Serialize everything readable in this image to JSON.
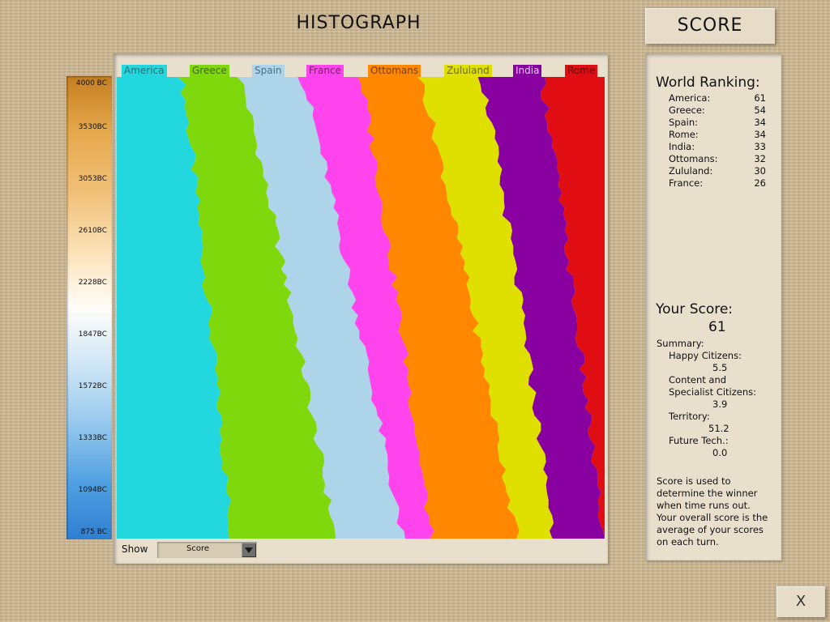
{
  "window": {
    "title": "HISTOGRAPH",
    "score_tab": "SCORE",
    "close_label": "X"
  },
  "timeline": {
    "ticks": [
      "4000 BC",
      "3530BC",
      "3053BC",
      "2610BC",
      "2228BC",
      "1847BC",
      "1572BC",
      "1333BC",
      "1094BC",
      "875 BC"
    ]
  },
  "legend": [
    {
      "name": "America",
      "color": "#22d8de",
      "text_color": "#2a6f77"
    },
    {
      "name": "Greece",
      "color": "#7ed80c",
      "text_color": "#3d6d0d"
    },
    {
      "name": "Spain",
      "color": "#aed4ea",
      "text_color": "#4a6f86"
    },
    {
      "name": "France",
      "color": "#ff44ee",
      "text_color": "#7a1f70"
    },
    {
      "name": "Ottomans",
      "color": "#ff8800",
      "text_color": "#7a3c00"
    },
    {
      "name": "Zululand",
      "color": "#e0e000",
      "text_color": "#6b6b00"
    },
    {
      "name": "India",
      "color": "#8800a0",
      "text_color": "#e8c8ff"
    },
    {
      "name": "Rome",
      "color": "#e00d12",
      "text_color": "#6b0000"
    }
  ],
  "controls": {
    "show_label": "Show",
    "show_value": "Score"
  },
  "world_ranking": {
    "title": "World Ranking:",
    "rows": [
      {
        "name": "America:",
        "score": "61"
      },
      {
        "name": "Greece:",
        "score": "54"
      },
      {
        "name": "Spain:",
        "score": "34"
      },
      {
        "name": "Rome:",
        "score": "34"
      },
      {
        "name": "India:",
        "score": "33"
      },
      {
        "name": "Ottomans:",
        "score": "32"
      },
      {
        "name": "Zululand:",
        "score": "30"
      },
      {
        "name": "France:",
        "score": "26"
      }
    ]
  },
  "your_score": {
    "title": "Your Score:",
    "value": "61",
    "summary_label": "Summary:",
    "happy_label": "Happy Citizens:",
    "happy_value": "5.5",
    "content_label_1": "Content and",
    "content_label_2": "Specialist Citizens:",
    "content_value": "3.9",
    "territory_label": "Territory:",
    "territory_value": "51.2",
    "future_label": "Future Tech.:",
    "future_value": "0.0",
    "note_lines": [
      "Score is used to",
      "determine the winner",
      "when time runs out.",
      "Your overall score is the",
      "average of your scores",
      "on each turn."
    ]
  }
}
